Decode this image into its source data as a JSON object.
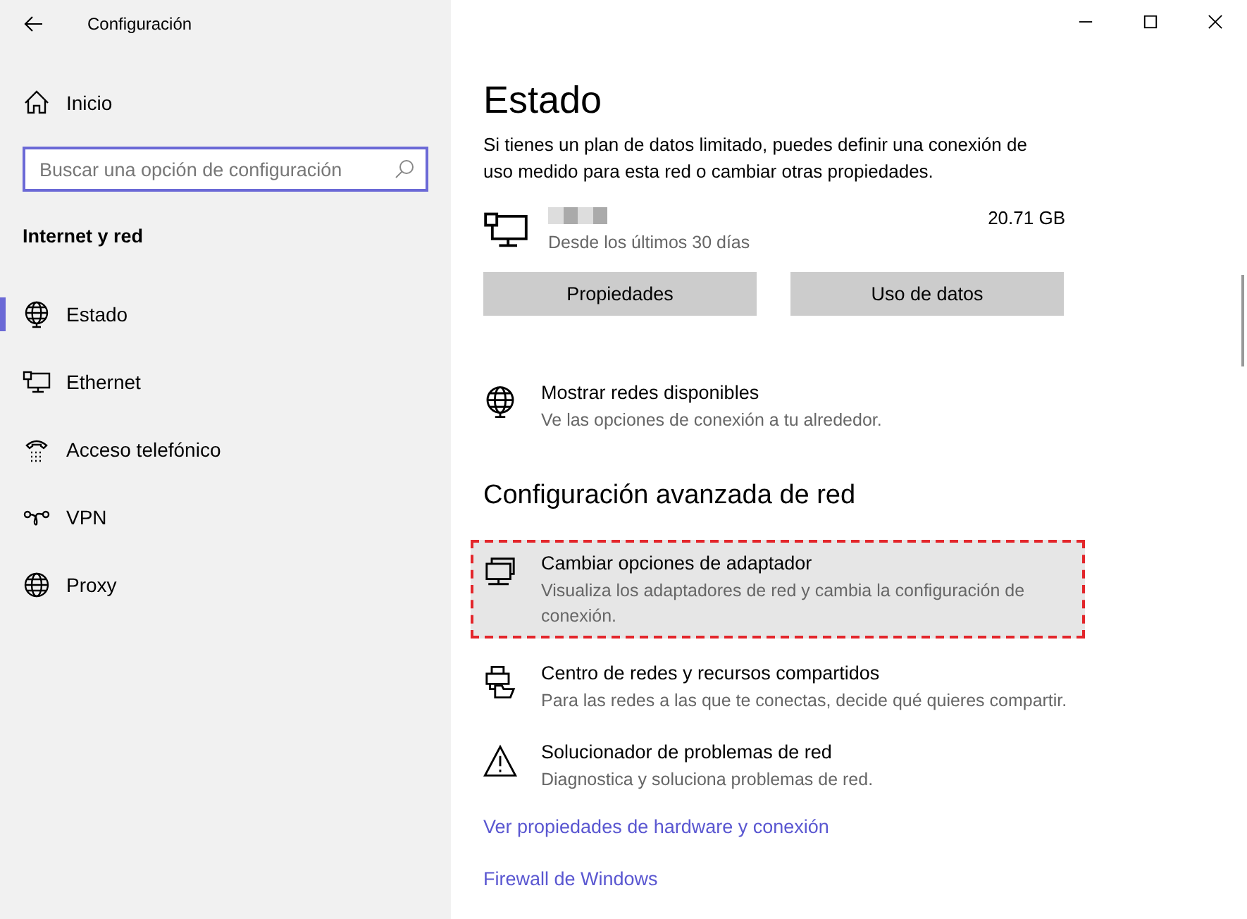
{
  "window": {
    "title": "Configuración"
  },
  "sidebar": {
    "home": "Inicio",
    "search": {
      "placeholder": "Buscar una opción de configuración"
    },
    "section": "Internet y red",
    "items": [
      {
        "label": "Estado",
        "kind": "status",
        "selected": true
      },
      {
        "label": "Ethernet",
        "kind": "ethernet",
        "selected": false
      },
      {
        "label": "Acceso telefónico",
        "kind": "dialup",
        "selected": false
      },
      {
        "label": "VPN",
        "kind": "vpn",
        "selected": false
      },
      {
        "label": "Proxy",
        "kind": "proxy",
        "selected": false
      }
    ]
  },
  "main": {
    "title": "Estado",
    "intro": "Si tienes un plan de datos limitado, puedes definir una conexión de uso medido para esta red o cambiar otras propiedades.",
    "network": {
      "period": "Desde los últimos 30 días",
      "usage": "20.71 GB"
    },
    "buttons": [
      "Propiedades",
      "Uso de datos"
    ],
    "show_networks": {
      "title": "Mostrar redes disponibles",
      "description": "Ve las opciones de conexión a tu alrededor.",
      "kind": "globe"
    },
    "advanced_title": "Configuración avanzada de red",
    "options": [
      {
        "title": "Cambiar opciones de adaptador",
        "description": "Visualiza los adaptadores de red y cambia la configuración de conexión.",
        "kind": "adapter",
        "highlighted": true
      },
      {
        "title": "Centro de redes y recursos compartidos",
        "description": "Para las redes a las que te conectas, decide qué quieres compartir.",
        "kind": "sharing",
        "highlighted": false
      },
      {
        "title": "Solucionador de problemas de red",
        "description": "Diagnostica y soluciona problemas de red.",
        "kind": "warning",
        "highlighted": false
      }
    ],
    "links": [
      "Ver propiedades de hardware y conexión",
      "Firewall de Windows"
    ]
  }
}
